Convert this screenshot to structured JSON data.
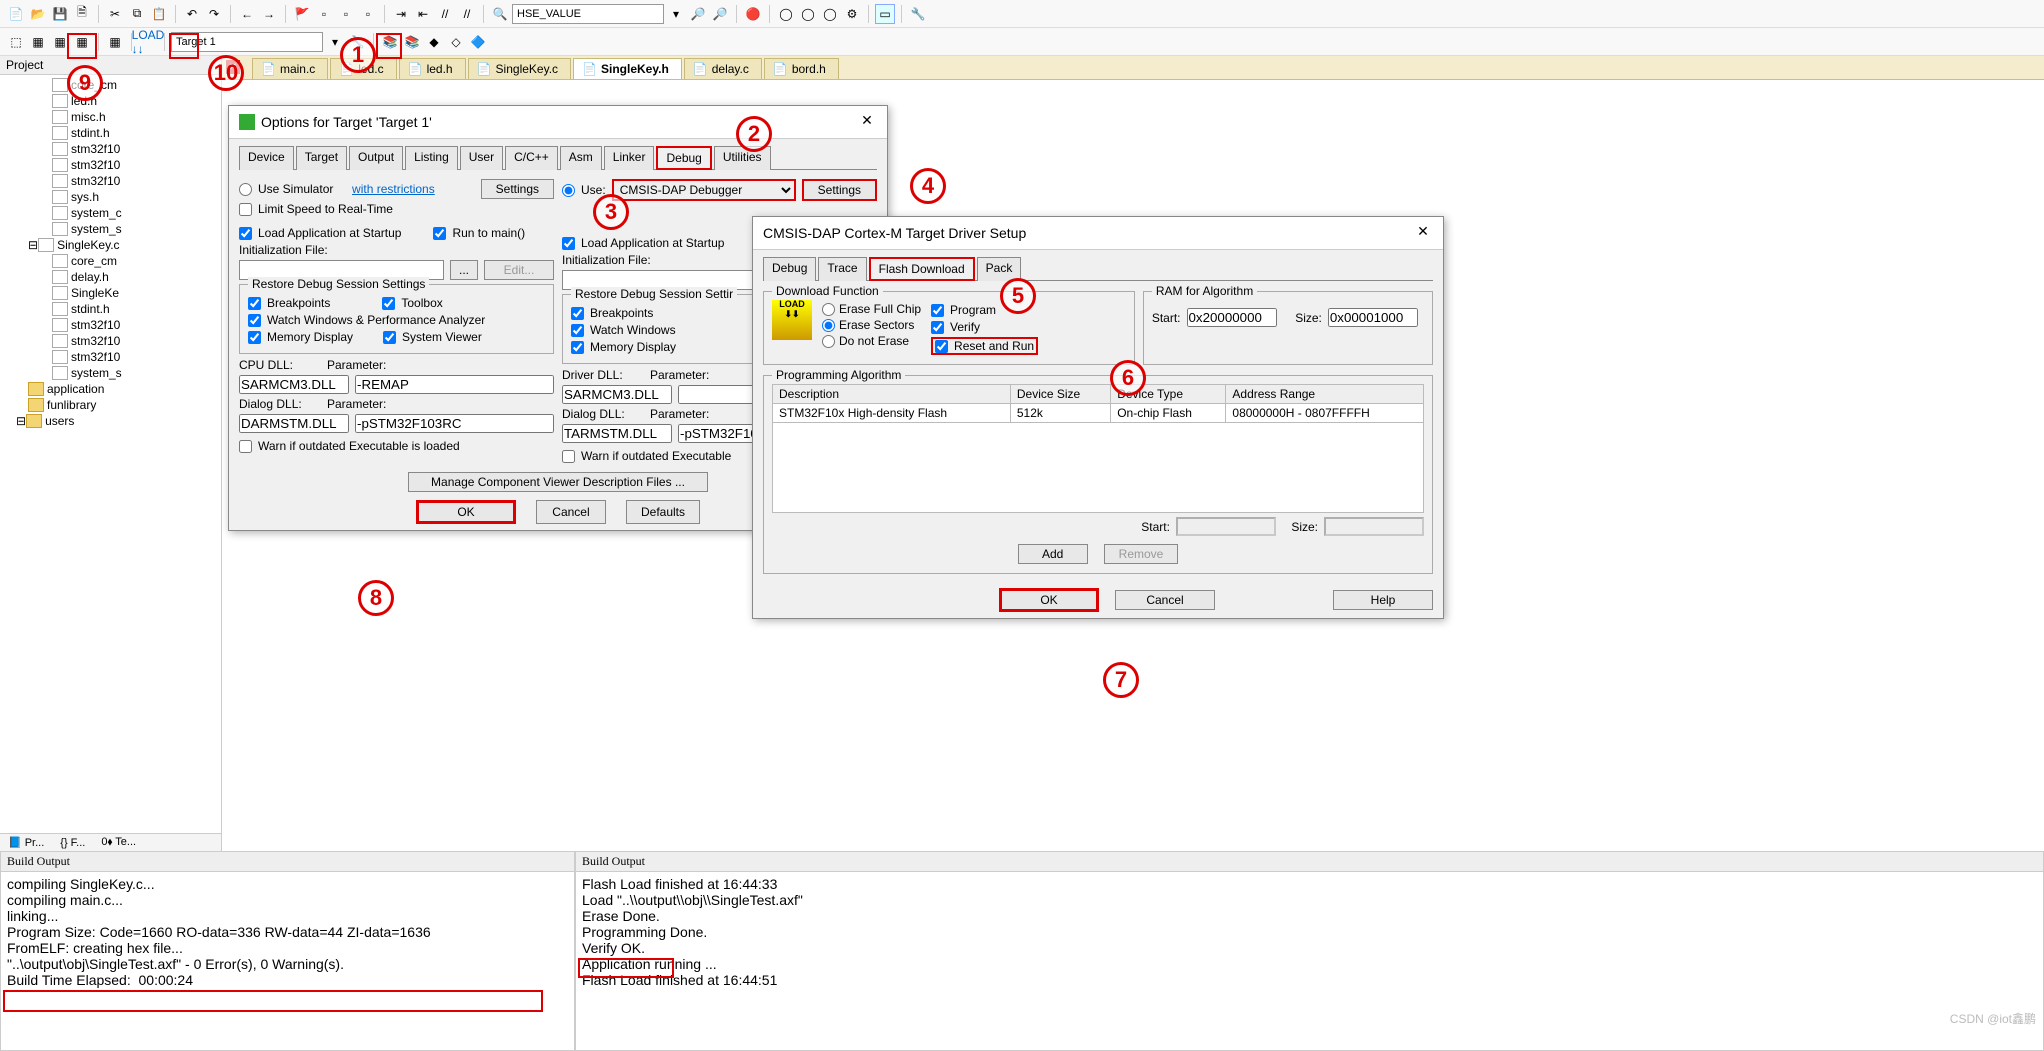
{
  "toolbar_combo": "HSE_VALUE",
  "target_combo": "Target 1",
  "project_panel_title": "Project",
  "tree": {
    "files_top": [
      "core_cm",
      "led.h",
      "misc.h",
      "stdint.h",
      "stm32f10",
      "stm32f10",
      "stm32f10",
      "sys.h",
      "system_c",
      "system_s"
    ],
    "group": "SingleKey.c",
    "files_group": [
      "core_cm",
      "delay.h",
      "SingleKe",
      "stdint.h",
      "stm32f10",
      "stm32f10",
      "stm32f10",
      "system_s"
    ],
    "folders": [
      "application",
      "funlibrary",
      "users"
    ]
  },
  "panel_tabs": [
    "Pr...",
    "{} F...",
    "0⬧ Te..."
  ],
  "file_tabs": [
    {
      "label": "main.c",
      "active": false
    },
    {
      "label": "led.c",
      "active": false
    },
    {
      "label": "led.h",
      "active": false
    },
    {
      "label": "SingleKey.c",
      "active": false
    },
    {
      "label": "SingleKey.h",
      "active": true
    },
    {
      "label": "delay.c",
      "active": false
    },
    {
      "label": "bord.h",
      "active": false
    }
  ],
  "options_dialog": {
    "title": "Options for Target 'Target 1'",
    "tabs": [
      "Device",
      "Target",
      "Output",
      "Listing",
      "User",
      "C/C++",
      "Asm",
      "Linker",
      "Debug",
      "Utilities"
    ],
    "active_tab": "Debug",
    "left": {
      "use_sim": "Use Simulator",
      "restrictions": "with restrictions",
      "settings": "Settings",
      "limit": "Limit Speed to Real-Time",
      "load_app": "Load Application at Startup",
      "run_main": "Run to main()",
      "init_file": "Initialization File:",
      "browse": "...",
      "edit": "Edit...",
      "restore_title": "Restore Debug Session Settings",
      "breakpoints": "Breakpoints",
      "toolbox": "Toolbox",
      "watch_perf": "Watch Windows & Performance Analyzer",
      "memdisp": "Memory Display",
      "sysviewer": "System Viewer",
      "cpu_dll_l": "CPU DLL:",
      "cpu_dll_v": "SARMCM3.DLL",
      "cpu_param_l": "Parameter:",
      "cpu_param_v": "-REMAP",
      "dlg_dll_l": "Dialog DLL:",
      "dlg_dll_v": "DARMSTM.DLL",
      "dlg_param_l": "Parameter:",
      "dlg_param_v": "-pSTM32F103RC",
      "warn": "Warn if outdated Executable is loaded",
      "manage_btn": "Manage Component Viewer Description Files ..."
    },
    "right": {
      "use": "Use:",
      "debugger": "CMSIS-DAP Debugger",
      "settings": "Settings",
      "load_app": "Load Application at Startup",
      "init_file": "Initialization File:",
      "restore_title": "Restore Debug Session Settir",
      "breakpoints": "Breakpoints",
      "watch": "Watch Windows",
      "memdisp": "Memory Display",
      "drv_dll_l": "Driver DLL:",
      "drv_dll_v": "SARMCM3.DLL",
      "drv_param_l": "Parameter:",
      "drv_param_v": "",
      "dlg_dll_l": "Dialog DLL:",
      "dlg_dll_v": "TARMSTM.DLL",
      "dlg_param_l": "Parameter:",
      "dlg_param_v": "-pSTM32F10",
      "warn": "Warn if outdated Executable"
    },
    "buttons": {
      "ok": "OK",
      "cancel": "Cancel",
      "defaults": "Defaults"
    }
  },
  "driver_dialog": {
    "title": "CMSIS-DAP Cortex-M Target Driver Setup",
    "tabs": [
      "Debug",
      "Trace",
      "Flash Download",
      "Pack"
    ],
    "active_tab": "Flash Download",
    "dlfunc_title": "Download Function",
    "erase_full": "Erase Full Chip",
    "erase_sectors": "Erase Sectors",
    "no_erase": "Do not Erase",
    "program": "Program",
    "verify": "Verify",
    "reset_run": "Reset and Run",
    "ram_title": "RAM for Algorithm",
    "start_l": "Start:",
    "start_v": "0x20000000",
    "size_l": "Size:",
    "size_v": "0x00001000",
    "alg_title": "Programming Algorithm",
    "cols": {
      "desc": "Description",
      "dsize": "Device Size",
      "dtype": "Device Type",
      "range": "Address Range"
    },
    "row": {
      "desc": "STM32F10x High-density Flash",
      "dsize": "512k",
      "dtype": "On-chip Flash",
      "range": "08000000H - 0807FFFFH"
    },
    "start2_l": "Start:",
    "size2_l": "Size:",
    "add": "Add",
    "remove": "Remove",
    "ok": "OK",
    "cancel": "Cancel",
    "help": "Help"
  },
  "build_left": {
    "title": "Build Output",
    "lines": "compiling SingleKey.c...\ncompiling main.c...\nlinking...\nProgram Size: Code=1660 RO-data=336 RW-data=44 ZI-data=1636\nFromELF: creating hex file...\n\"..\\output\\obj\\SingleTest.axf\" - 0 Error(s), 0 Warning(s).\nBuild Time Elapsed:  00:00:24"
  },
  "build_right": {
    "title": "Build Output",
    "lines": "Flash Load finished at 16:44:33\nLoad \"..\\\\output\\\\obj\\\\SingleTest.axf\"\nErase Done.\nProgramming Done.\nVerify OK.\nApplication running ...\nFlash Load finished at 16:44:51"
  },
  "watermark": "CSDN @iot鑫鹏",
  "annotations": {
    "1": "1",
    "2": "2",
    "3": "3",
    "4": "4",
    "5": "5",
    "6": "6",
    "7": "7",
    "8": "8",
    "9": "9",
    "10": "10"
  }
}
